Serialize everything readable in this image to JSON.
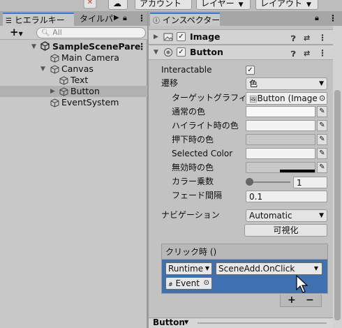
{
  "toolbar": {
    "account_label": "アカウント",
    "layers_label": "レイヤー",
    "layout_label": "レイアウト"
  },
  "hierarchy": {
    "tab_label": "ヒエラルキー",
    "tab2_label": "タイルパレ",
    "add_label": "+",
    "search_placeholder": "All",
    "scene_name": "SampleScenePare",
    "items": [
      {
        "label": "Main Camera"
      },
      {
        "label": "Canvas"
      },
      {
        "label": "Text"
      },
      {
        "label": "Button"
      },
      {
        "label": "EventSystem"
      }
    ]
  },
  "inspector": {
    "tab_label": "インスペクター",
    "image_component": "Image",
    "button_component": "Button",
    "interactable_label": "Interactable",
    "transition_label": "遷移",
    "transition_value": "色",
    "target_graphic_label": "ターゲットグラフィックス",
    "target_graphic_value": "Button (Image",
    "normal_color_label": "通常の色",
    "highlight_color_label": "ハイライト時の色",
    "pressed_color_label": "押下時の色",
    "selected_color_label": "Selected Color",
    "disabled_color_label": "無効時の色",
    "color_multiplier_label": "カラー乗数",
    "color_multiplier_value": "1",
    "fade_duration_label": "フェード間隔",
    "fade_duration_value": "0.1",
    "navigation_label": "ナビゲーション",
    "navigation_value": "Automatic",
    "visualize_label": "可視化",
    "onclick_label": "クリック時 ()",
    "runtime_value": "Runtime",
    "function_value": "SceneAdd.OnClick",
    "object_value": "Event",
    "add_event_label": "+",
    "remove_event_label": "−",
    "bottom_label": "Button"
  }
}
